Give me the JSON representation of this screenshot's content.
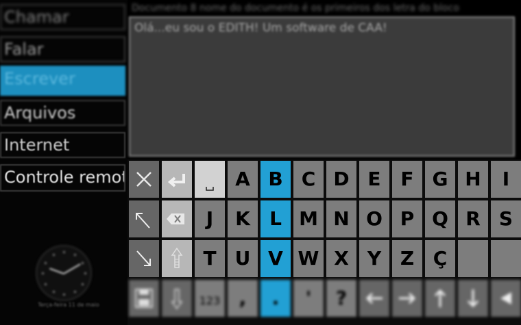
{
  "sidebar": {
    "items": [
      {
        "label": "Chamar"
      },
      {
        "label": "Falar"
      },
      {
        "label": "Escrever"
      },
      {
        "label": "Arquivos"
      },
      {
        "label": "Internet"
      },
      {
        "label": "Controle remoto"
      }
    ],
    "active_index": 2
  },
  "clock": {
    "date_text": "Terça-feira 11 de maio"
  },
  "document": {
    "title": "Documento 8 nome do documento é os primeiros dos letra do bloco",
    "text": "Olá...eu sou o EDITH! Um software de CAA!"
  },
  "keyboard": {
    "highlight_color": "#22a0d4",
    "rows": [
      [
        {
          "name": "close-key",
          "icon": "close-icon"
        },
        {
          "name": "enter-key",
          "icon": "enter-icon"
        },
        {
          "name": "space-key",
          "icon": "space-icon"
        },
        {
          "name": "key-a",
          "label": "A"
        },
        {
          "name": "key-b",
          "label": "B",
          "highlight": true
        },
        {
          "name": "key-c",
          "label": "C"
        },
        {
          "name": "key-d",
          "label": "D"
        },
        {
          "name": "key-e",
          "label": "E"
        },
        {
          "name": "key-f",
          "label": "F"
        },
        {
          "name": "key-g",
          "label": "G"
        },
        {
          "name": "key-h",
          "label": "H"
        },
        {
          "name": "key-i",
          "label": "I"
        }
      ],
      [
        {
          "name": "arrow-up-left-key",
          "icon": "arrow-up-left-icon"
        },
        {
          "name": "backspace-key",
          "icon": "backspace-icon"
        },
        {
          "name": "key-j",
          "label": "J"
        },
        {
          "name": "key-k",
          "label": "K"
        },
        {
          "name": "key-l",
          "label": "L",
          "highlight": true
        },
        {
          "name": "key-m",
          "label": "M"
        },
        {
          "name": "key-n",
          "label": "N"
        },
        {
          "name": "key-o",
          "label": "O"
        },
        {
          "name": "key-p",
          "label": "P"
        },
        {
          "name": "key-q",
          "label": "Q"
        },
        {
          "name": "key-r",
          "label": "R"
        },
        {
          "name": "key-s",
          "label": "S"
        }
      ],
      [
        {
          "name": "arrow-down-right-key",
          "icon": "arrow-down-right-icon"
        },
        {
          "name": "shift-key",
          "icon": "shift-icon"
        },
        {
          "name": "key-t",
          "label": "T"
        },
        {
          "name": "key-u",
          "label": "U"
        },
        {
          "name": "key-v",
          "label": "V",
          "highlight": true
        },
        {
          "name": "key-w",
          "label": "W"
        },
        {
          "name": "key-x",
          "label": "X"
        },
        {
          "name": "key-y",
          "label": "Y"
        },
        {
          "name": "key-z",
          "label": "Z"
        },
        {
          "name": "key-c-cedilla",
          "label": "Ç"
        },
        {
          "name": "empty-key",
          "label": ""
        },
        {
          "name": "empty-key",
          "label": ""
        }
      ],
      [
        {
          "name": "save-key",
          "icon": "save-icon"
        },
        {
          "name": "shift-down-key",
          "icon": "shift-down-icon"
        },
        {
          "name": "numbers-key",
          "label": "123"
        },
        {
          "name": "comma-key",
          "label": ","
        },
        {
          "name": "period-key",
          "label": ".",
          "highlight": true
        },
        {
          "name": "apostrophe-key",
          "label": "'"
        },
        {
          "name": "question-key",
          "label": "?"
        },
        {
          "name": "cursor-left-key",
          "icon": "arrow-left-icon"
        },
        {
          "name": "cursor-right-key",
          "icon": "arrow-right-icon"
        },
        {
          "name": "cursor-up-key",
          "icon": "arrow-up-icon"
        },
        {
          "name": "cursor-down-key",
          "icon": "arrow-down-icon"
        },
        {
          "name": "delete-key",
          "icon": "delete-icon"
        }
      ]
    ]
  }
}
